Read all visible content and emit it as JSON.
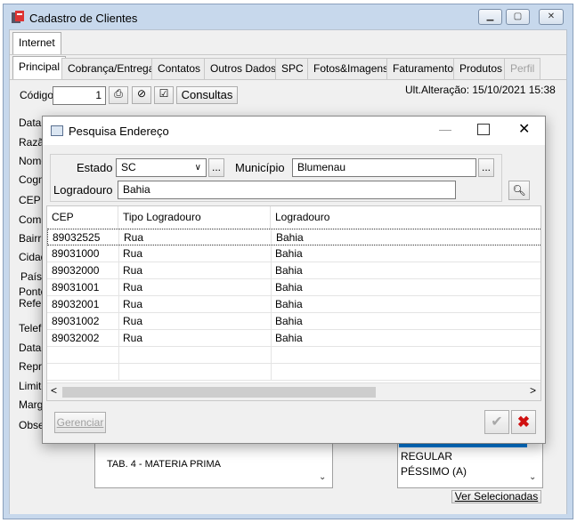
{
  "main_window": {
    "title": "Cadastro de Clientes",
    "top_tab": "Internet",
    "tabs": [
      "Principal",
      "Cobrança/Entrega",
      "Contatos",
      "Outros Dados",
      "SPC",
      "Fotos&Imagens",
      "Faturamento",
      "Produtos",
      "Perfil"
    ],
    "codigo_label": "Código",
    "codigo_value": "1",
    "consultas_label": "Consultas",
    "ult_alteracao": "Ult.Alteração: 15/10/2021 15:38",
    "field_labels": [
      "Data",
      "Razã",
      "Nome",
      "Cogn",
      "CEP",
      "Comp",
      "Bairr",
      "Cidad",
      "País:",
      "Ponto",
      "Refer",
      "Telef",
      "Data",
      "Repre",
      "Limite",
      "Marg",
      "Obse"
    ],
    "tab_list_item": "TAB. 4 - MATERIA PRIMA",
    "rating_items": [
      "REGULAR",
      "PÉSSIMO (A)"
    ],
    "ver_selecionadas": "Ver Selecionadas"
  },
  "dialog": {
    "title": "Pesquisa Endereço",
    "estado_label": "Estado",
    "estado_value": "SC",
    "municipio_label": "Município",
    "municipio_value": "Blumenau",
    "logradouro_label": "Logradouro",
    "logradouro_value": "Bahia",
    "columns": [
      "CEP",
      "Tipo Logradouro",
      "Logradouro"
    ],
    "rows": [
      [
        "89032525",
        "Rua",
        "Bahia"
      ],
      [
        "89031000",
        "Rua",
        "Bahia"
      ],
      [
        "89032000",
        "Rua",
        "Bahia"
      ],
      [
        "89031001",
        "Rua",
        "Bahia"
      ],
      [
        "89032001",
        "Rua",
        "Bahia"
      ],
      [
        "89031002",
        "Rua",
        "Bahia"
      ],
      [
        "89032002",
        "Rua",
        "Bahia"
      ]
    ],
    "gerenciar_label": "Gerenciar",
    "ellipsis": "..."
  }
}
